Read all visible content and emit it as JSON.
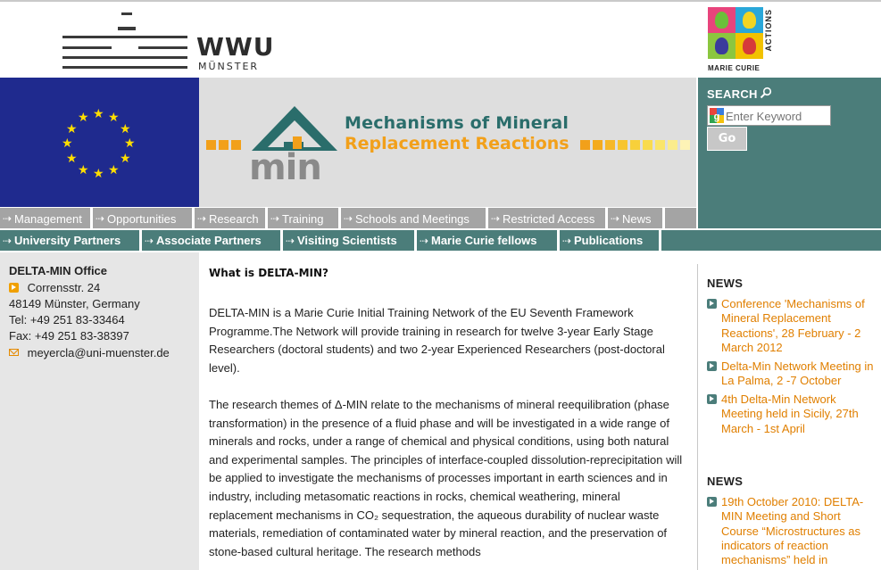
{
  "header": {
    "university_name": "WWU",
    "university_city": "MÜNSTER",
    "marie_curie_logo": {
      "vertical_text": "ACTIONS",
      "bottom_text": "MARIE CURIE"
    }
  },
  "banner": {
    "logo_line1": "Mechanisms of Mineral",
    "logo_line2": "Replacement Reactions",
    "logo_word": "min"
  },
  "search": {
    "label": "SEARCH",
    "placeholder": "Enter Keyword",
    "button": "Go"
  },
  "nav_primary": [
    {
      "label": "Management"
    },
    {
      "label": "Opportunities"
    },
    {
      "label": "Research"
    },
    {
      "label": "Training"
    },
    {
      "label": "Schools and Meetings"
    },
    {
      "label": "Restricted Access"
    },
    {
      "label": "News"
    }
  ],
  "nav_secondary": [
    {
      "label": "University Partners"
    },
    {
      "label": "Associate Partners"
    },
    {
      "label": "Visiting Scientists"
    },
    {
      "label": "Marie Curie fellows"
    },
    {
      "label": "Publications"
    }
  ],
  "office": {
    "title": "DELTA-MIN Office",
    "street": "Corrensstr. 24",
    "city": "48149 Münster, Germany",
    "tel": "Tel: +49 251 83-33464",
    "fax": "Fax: +49 251 83-38397",
    "email": "meyercla@uni-muenster.de"
  },
  "main": {
    "title": "What is DELTA-MIN?",
    "paragraph1": "DELTA-MIN is a Marie Curie Initial Training Network of the EU Seventh Framework Programme.The Network will provide training in research for twelve 3-year Early Stage Researchers (doctoral students) and two 2-year Experienced Researchers (post-doctoral level).",
    "paragraph2": "The research themes of Δ-MIN relate to the mechanisms of mineral reequilibration (phase transformation) in the presence of a fluid phase and will be investigated in a wide range of minerals and rocks, under a range of chemical and physical conditions, using both natural and experimental samples. The principles of interface-coupled dissolution-reprecipitation will be applied to investigate the mechanisms of processes important in earth sciences and in industry, including metasomatic reactions in rocks, chemical weathering, mineral replacement mechanisms in CO₂ sequestration, the aqueous durability of nuclear waste materials, remediation of contaminated water by mineral reaction, and the preservation of stone-based cultural heritage. The research methods"
  },
  "news": {
    "heading1": "NEWS",
    "items1": [
      {
        "text": "Conference 'Mechanisms of Mineral Replacement Reactions', 28 February - 2 March 2012"
      },
      {
        "text": "Delta-Min Network Meeting in La Palma, 2 -7 October"
      },
      {
        "text": "4th Delta-Min Network Meeting held in Sicily, 27th March - 1st April"
      }
    ],
    "heading2": "NEWS",
    "items2": [
      {
        "text": "19th October 2010: DELTA-MIN Meeting and Short Course “Microstructures as indicators of reaction mechanisms” held in"
      }
    ]
  },
  "colors": {
    "eu_blue": "#1f2a8e",
    "eu_star": "#ffde00",
    "teal": "#4b7d7a",
    "nav_grey": "#a4a4a4",
    "accent_orange": "#e07f00"
  }
}
